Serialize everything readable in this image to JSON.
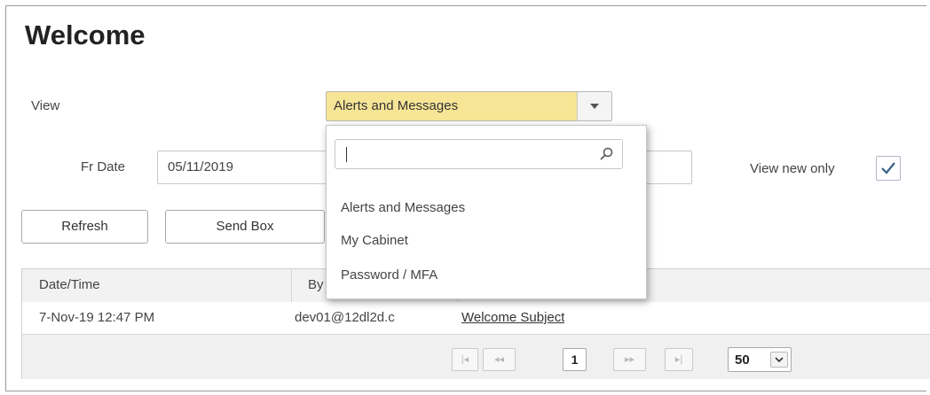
{
  "page": {
    "title": "Welcome"
  },
  "view": {
    "label": "View",
    "selected": "Alerts and Messages"
  },
  "dropdown": {
    "search_value": "",
    "options": [
      "Alerts and Messages",
      "My Cabinet",
      "Password / MFA"
    ]
  },
  "filters": {
    "fr_date_label": "Fr Date",
    "fr_date_value": "05/11/2019",
    "to_date_value": "",
    "view_new_only_label": "View new only",
    "view_new_only_checked": true
  },
  "toolbar": {
    "refresh_label": "Refresh",
    "send_box_label": "Send Box"
  },
  "grid": {
    "columns": [
      "Date/Time",
      "By",
      ""
    ],
    "rows": [
      {
        "datetime": "7-Nov-19 12:47 PM",
        "by": "dev01@12dl2d.c",
        "subject": "Welcome Subject"
      }
    ]
  },
  "pager": {
    "first": "|◂",
    "prev": "◂◂",
    "current_page": "1",
    "next": "▸▸",
    "last": "▸|",
    "page_size": "50"
  },
  "colors": {
    "selected_bg": "#f7e596",
    "checkbox_check": "#3a5f86"
  }
}
